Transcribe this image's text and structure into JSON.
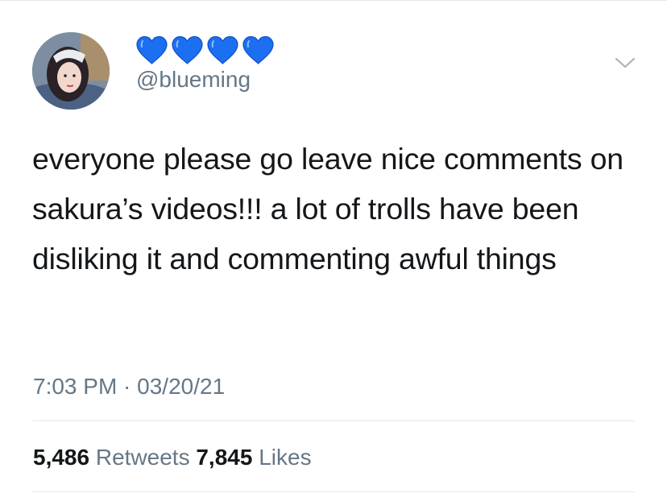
{
  "tweet": {
    "display_name_icons": [
      "blue-heart-icon",
      "blue-heart-icon",
      "blue-heart-icon",
      "blue-heart-icon"
    ],
    "heart_color": "#1d6ff2",
    "handle": "@blueming",
    "text": "everyone please go leave nice comments on sakura’s videos!!! a lot of trolls have been disliking it and commenting awful things",
    "timestamp": "7:03 PM · 03/20/21",
    "retweets_count": "5,486",
    "retweets_label": "Retweets",
    "likes_count": "7,845",
    "likes_label": "Likes",
    "menu_icon": "chevron-down-icon"
  }
}
